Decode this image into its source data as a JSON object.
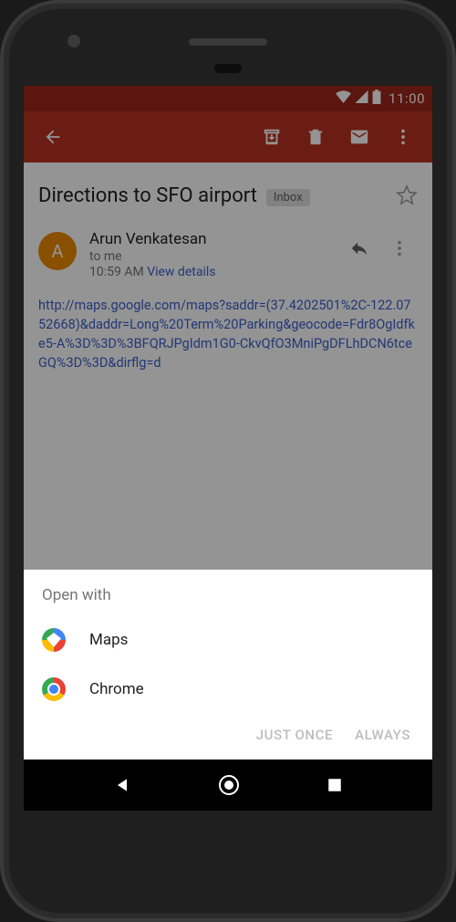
{
  "statusbar": {
    "time": "11:00"
  },
  "email": {
    "subject": "Directions to SFO airport",
    "label": "Inbox",
    "sender_name": "Arun Venkatesan",
    "sender_initial": "A",
    "to_line": "to me",
    "time": "10:59 AM",
    "details_label": "View details",
    "body_link": "http://maps.google.com/maps?saddr=(37.4202501%2C-122.0752668)&daddr=Long%20Term%20Parking&geocode=Fdr8OgIdfke5-A%3D%3D%3BFQRJPgIdm1G0-CkvQfO3MniPgDFLhDCN6tceGQ%3D%3D&dirflg=d"
  },
  "sheet": {
    "title": "Open with",
    "items": [
      {
        "label": "Maps"
      },
      {
        "label": "Chrome"
      }
    ],
    "just_once": "JUST ONCE",
    "always": "ALWAYS"
  }
}
